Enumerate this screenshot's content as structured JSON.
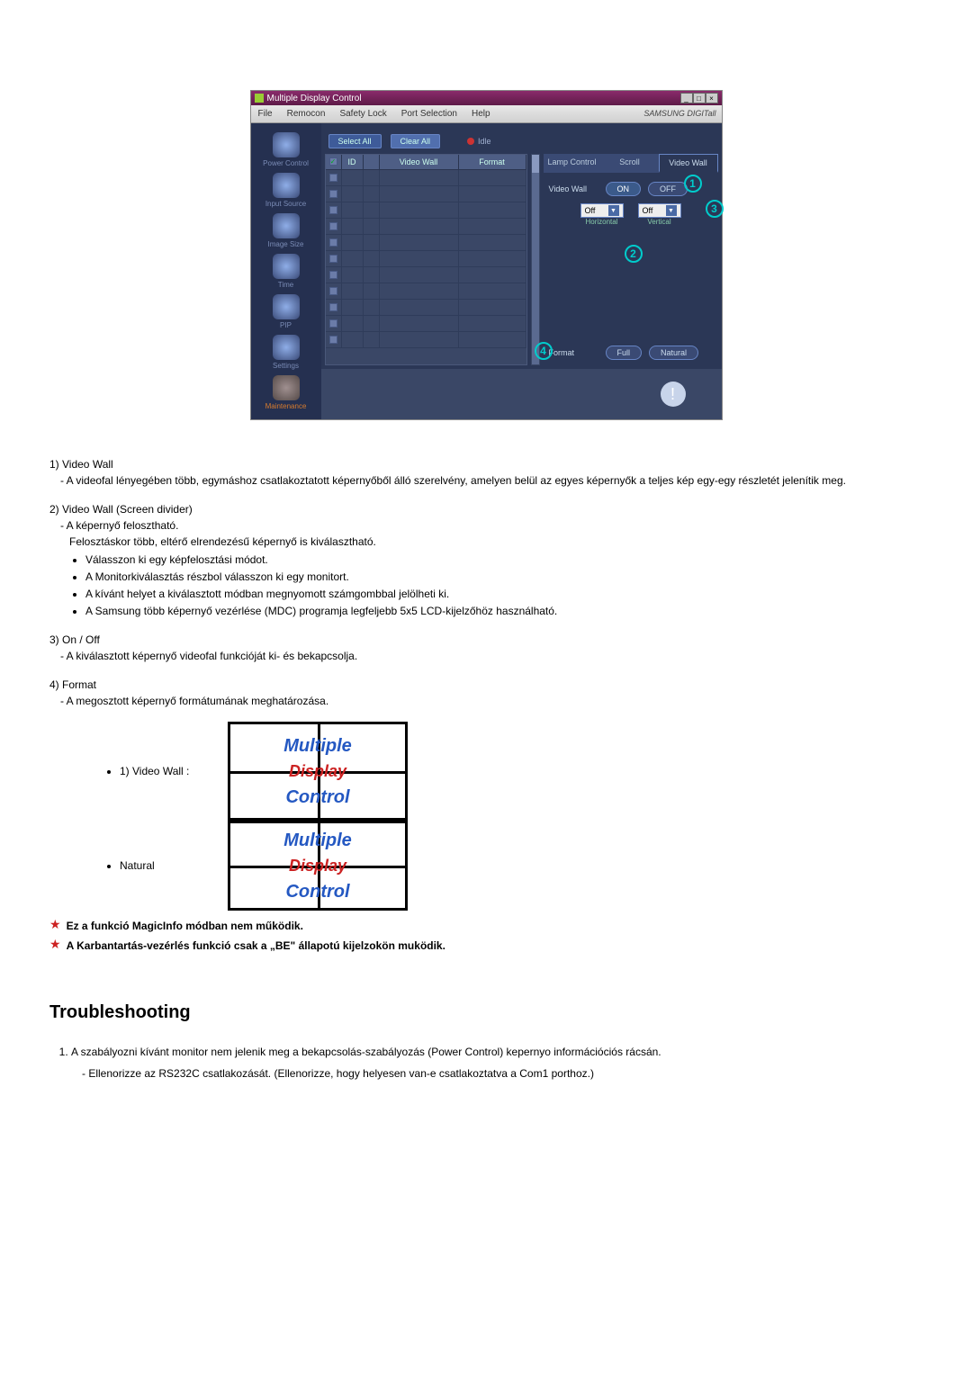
{
  "app": {
    "title": "Multiple Display Control",
    "brand": "SAMSUNG DIGITall",
    "menu": [
      "File",
      "Remocon",
      "Safety Lock",
      "Port Selection",
      "Help"
    ],
    "sidebar": [
      {
        "label": "Power Control"
      },
      {
        "label": "Input Source"
      },
      {
        "label": "Image Size"
      },
      {
        "label": "Time"
      },
      {
        "label": "PIP"
      },
      {
        "label": "Settings"
      },
      {
        "label": "Maintenance"
      }
    ],
    "toolbar": {
      "select_all": "Select All",
      "clear_all": "Clear All",
      "idle": "Idle"
    },
    "grid": {
      "headers": {
        "id": "ID",
        "video_wall": "Video Wall",
        "format": "Format"
      }
    },
    "tabs": {
      "lamp": "Lamp Control",
      "scroll": "Scroll",
      "videowall": "Video Wall"
    },
    "panel": {
      "videowall_label": "Video Wall",
      "on": "ON",
      "off": "OFF",
      "horiz_value": "Off",
      "vert_value": "Off",
      "horiz_label": "Horizontal",
      "vert_label": "Vertical",
      "format_label": "Format",
      "full": "Full",
      "natural": "Natural"
    },
    "callouts": {
      "c1": "1",
      "c2": "2",
      "c3": "3",
      "c4": "4"
    }
  },
  "doc": {
    "item1": {
      "title": "1) Video Wall",
      "line": "A videofal lényegében több, egymáshoz csatlakoztatott képernyőből álló szerelvény, amelyen belül az egyes képernyők a teljes kép egy-egy részletét jelenítik meg."
    },
    "item2": {
      "title": "2) Video Wall (Screen divider)",
      "line1": "A képernyő felosztható.",
      "line2": "Felosztáskor több, eltérő elrendezésű képernyő is kiválasztható.",
      "bullets": [
        "Válasszon ki egy képfelosztási módot.",
        "A Monitorkiválasztás részbol válasszon ki egy monitort.",
        "A kívánt helyet a kiválasztott módban megnyomott számgombbal jelölheti ki.",
        "A Samsung több képernyő vezérlése (MDC) programja legfeljebb 5x5 LCD-kijelzőhöz használható."
      ]
    },
    "item3": {
      "title": "3) On / Off",
      "line": "A kiválasztott képernyő videofal funkcióját ki- és bekapcsolja."
    },
    "item4": {
      "title": "4) Format",
      "line": "A megosztott képernyő formátumának meghatározása."
    },
    "vw_labels": {
      "row1": "1) Video Wall :",
      "row2": "Natural"
    },
    "preview_text": {
      "t1": "Multiple",
      "t2": "Display",
      "t3": "Control"
    },
    "note1": "Ez a funkció MagicInfo módban nem működik.",
    "note2": "A Karbantartás-vezérlés funkció csak a „BE\" állapotú kijelzokön muködik.",
    "troubleshoot_heading": "Troubleshooting",
    "ts_item1": "A szabályozni kívánt monitor nem jelenik meg a bekapcsolás-szabályozás (Power Control) kepernyo információciós rácsán.",
    "ts_item1_sub": "Ellenorizze az RS232C csatlakozását. (Ellenorizze, hogy helyesen van-e csatlakoztatva a Com1 porthoz.)"
  }
}
